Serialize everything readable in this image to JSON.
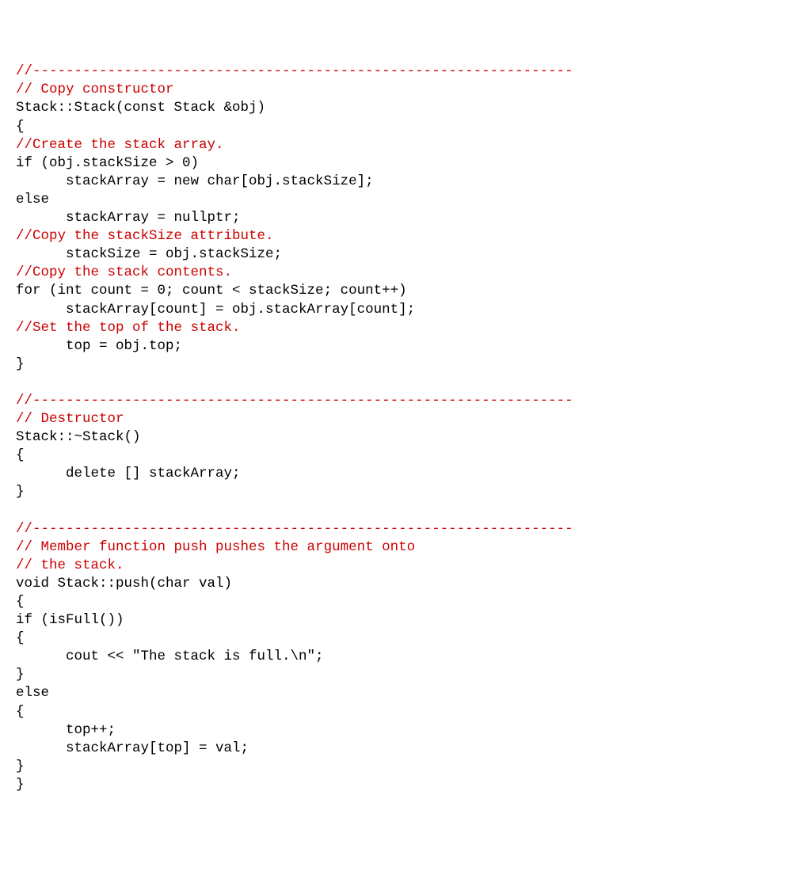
{
  "code": {
    "lines": [
      {
        "cls": "comment",
        "text": "//-----------------------------------------------------------------"
      },
      {
        "cls": "comment",
        "text": "// Copy constructor"
      },
      {
        "cls": "code",
        "text": "Stack::Stack(const Stack &obj)"
      },
      {
        "cls": "code",
        "text": "{"
      },
      {
        "cls": "comment",
        "text": "//Create the stack array."
      },
      {
        "cls": "code",
        "text": "if (obj.stackSize > 0)"
      },
      {
        "cls": "code",
        "text": "      stackArray = new char[obj.stackSize];"
      },
      {
        "cls": "code",
        "text": "else"
      },
      {
        "cls": "code",
        "text": "      stackArray = nullptr;"
      },
      {
        "cls": "comment",
        "text": "//Copy the stackSize attribute."
      },
      {
        "cls": "code",
        "text": "      stackSize = obj.stackSize;"
      },
      {
        "cls": "comment",
        "text": "//Copy the stack contents."
      },
      {
        "cls": "code",
        "text": "for (int count = 0; count < stackSize; count++)"
      },
      {
        "cls": "code",
        "text": "      stackArray[count] = obj.stackArray[count];"
      },
      {
        "cls": "comment",
        "text": "//Set the top of the stack."
      },
      {
        "cls": "code",
        "text": "      top = obj.top;"
      },
      {
        "cls": "code",
        "text": "}"
      },
      {
        "cls": "code",
        "text": ""
      },
      {
        "cls": "comment",
        "text": "//-----------------------------------------------------------------"
      },
      {
        "cls": "comment",
        "text": "// Destructor"
      },
      {
        "cls": "code",
        "text": "Stack::~Stack()"
      },
      {
        "cls": "code",
        "text": "{"
      },
      {
        "cls": "code",
        "text": "      delete [] stackArray;"
      },
      {
        "cls": "code",
        "text": "}"
      },
      {
        "cls": "code",
        "text": ""
      },
      {
        "cls": "comment",
        "text": "//-----------------------------------------------------------------"
      },
      {
        "cls": "comment",
        "text": "// Member function push pushes the argument onto"
      },
      {
        "cls": "comment",
        "text": "// the stack."
      },
      {
        "cls": "code",
        "text": "void Stack::push(char val)"
      },
      {
        "cls": "code",
        "text": "{"
      },
      {
        "cls": "code",
        "text": "if (isFull())"
      },
      {
        "cls": "code",
        "text": "{"
      },
      {
        "cls": "code",
        "text": "      cout << \"The stack is full.\\n\";"
      },
      {
        "cls": "code",
        "text": "}"
      },
      {
        "cls": "code",
        "text": "else"
      },
      {
        "cls": "code",
        "text": "{"
      },
      {
        "cls": "code",
        "text": "      top++;"
      },
      {
        "cls": "code",
        "text": "      stackArray[top] = val;"
      },
      {
        "cls": "code",
        "text": "}"
      },
      {
        "cls": "code",
        "text": "}"
      }
    ]
  }
}
